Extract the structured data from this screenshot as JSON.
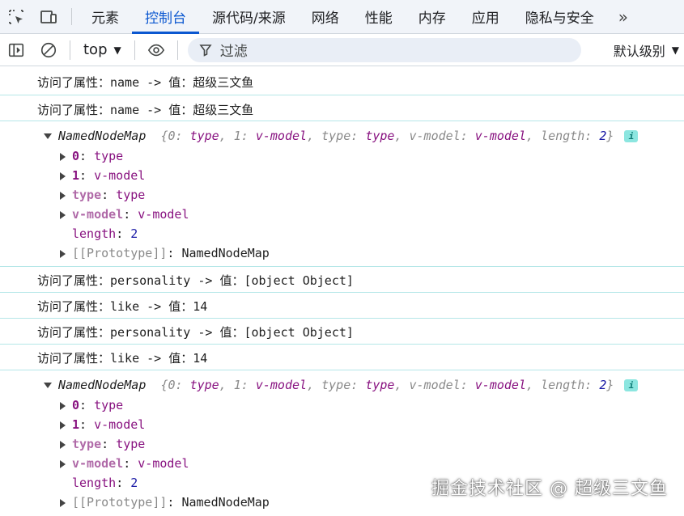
{
  "devtools": {
    "tabs": [
      {
        "label": "元素"
      },
      {
        "label": "控制台",
        "active": true
      },
      {
        "label": "源代码/来源"
      },
      {
        "label": "网络"
      },
      {
        "label": "性能"
      },
      {
        "label": "内存"
      },
      {
        "label": "应用"
      },
      {
        "label": "隐私与安全"
      }
    ],
    "more_label": "»"
  },
  "toolbar": {
    "context": "top",
    "filter_placeholder": "过滤",
    "level": "默认级别"
  },
  "console": {
    "log1": "访问了属性：name -> 值：超级三文鱼",
    "log2": "访问了属性：name -> 值：超级三文鱼",
    "map1": {
      "name": "NamedNodeMap",
      "preview": {
        "open": "{",
        "k0": "0",
        "v0": "type",
        "k1": "1",
        "v1": "v-model",
        "k2": "type",
        "v2": "type",
        "k3": "v-model",
        "v3": "v-model",
        "k4": "length",
        "v4": "2",
        "close": "}"
      },
      "props": [
        {
          "key": "0",
          "value": "type"
        },
        {
          "key": "1",
          "value": "v-model"
        },
        {
          "key": "type",
          "value": "type"
        },
        {
          "key": "v-model",
          "value": "v-model"
        }
      ],
      "length_key": "length",
      "length_value": "2",
      "proto_key": "[[Prototype]]",
      "proto_value": "NamedNodeMap",
      "badge": "i"
    },
    "log3": "访问了属性：personality -> 值：[object Object]",
    "log4": "访问了属性：like -> 值：14",
    "log5": "访问了属性：personality -> 值：[object Object]",
    "log6": "访问了属性：like -> 值：14",
    "map2": {
      "name": "NamedNodeMap",
      "preview": {
        "open": "{",
        "k0": "0",
        "v0": "type",
        "k1": "1",
        "v1": "v-model",
        "k2": "type",
        "v2": "type",
        "k3": "v-model",
        "v3": "v-model",
        "k4": "length",
        "v4": "2",
        "close": "}"
      },
      "props": [
        {
          "key": "0",
          "value": "type"
        },
        {
          "key": "1",
          "value": "v-model"
        },
        {
          "key": "type",
          "value": "type"
        },
        {
          "key": "v-model",
          "value": "v-model"
        }
      ],
      "length_key": "length",
      "length_value": "2",
      "proto_key": "[[Prototype]]",
      "proto_value": "NamedNodeMap",
      "badge": "i"
    }
  },
  "watermark": "掘金技术社区 @ 超级三文鱼",
  "colors": {
    "accent": "#0b57d0",
    "row_border": "#b5e7e8",
    "badge_bg": "#8ce6e0",
    "prop_key": "#881280",
    "number": "#1a1aa6"
  }
}
